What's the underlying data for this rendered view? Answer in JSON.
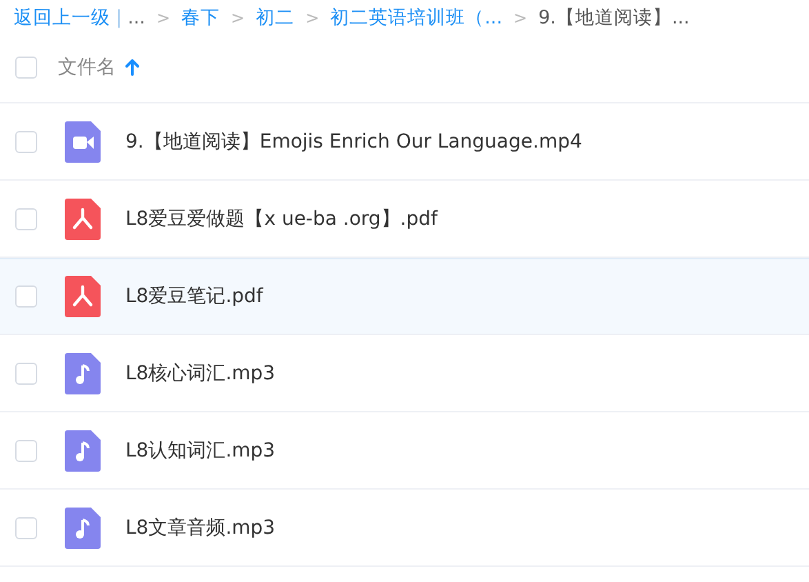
{
  "breadcrumb": [
    {
      "kind": "back",
      "text": "返回上一级"
    },
    {
      "kind": "divider",
      "text": "|"
    },
    {
      "kind": "more",
      "text": "..."
    },
    {
      "kind": "sep",
      "text": ">"
    },
    {
      "kind": "link",
      "text": "春下"
    },
    {
      "kind": "sep",
      "text": ">"
    },
    {
      "kind": "link",
      "text": "初二"
    },
    {
      "kind": "sep",
      "text": ">"
    },
    {
      "kind": "link",
      "text": "初二英语培训班（..."
    },
    {
      "kind": "sep",
      "text": ">"
    },
    {
      "kind": "current",
      "text": "9.【地道阅读】..."
    }
  ],
  "header": {
    "checked": false,
    "label": "文件名",
    "sort_ascending": true
  },
  "files": [
    {
      "kind": "video",
      "name": "9.【地道阅读】Emojis Enrich Our Language.mp4",
      "checked": false,
      "selected": false
    },
    {
      "kind": "pdf",
      "name": "L8爱豆爱做题【x ue-ba .org】.pdf",
      "checked": false,
      "selected": false
    },
    {
      "kind": "pdf",
      "name": "L8爱豆笔记.pdf",
      "checked": false,
      "selected": true
    },
    {
      "kind": "audio",
      "name": "L8核心词汇.mp3",
      "checked": false,
      "selected": false
    },
    {
      "kind": "audio",
      "name": "L8认知词汇.mp3",
      "checked": false,
      "selected": false
    },
    {
      "kind": "audio",
      "name": "L8文章音频.mp3",
      "checked": false,
      "selected": false
    }
  ]
}
